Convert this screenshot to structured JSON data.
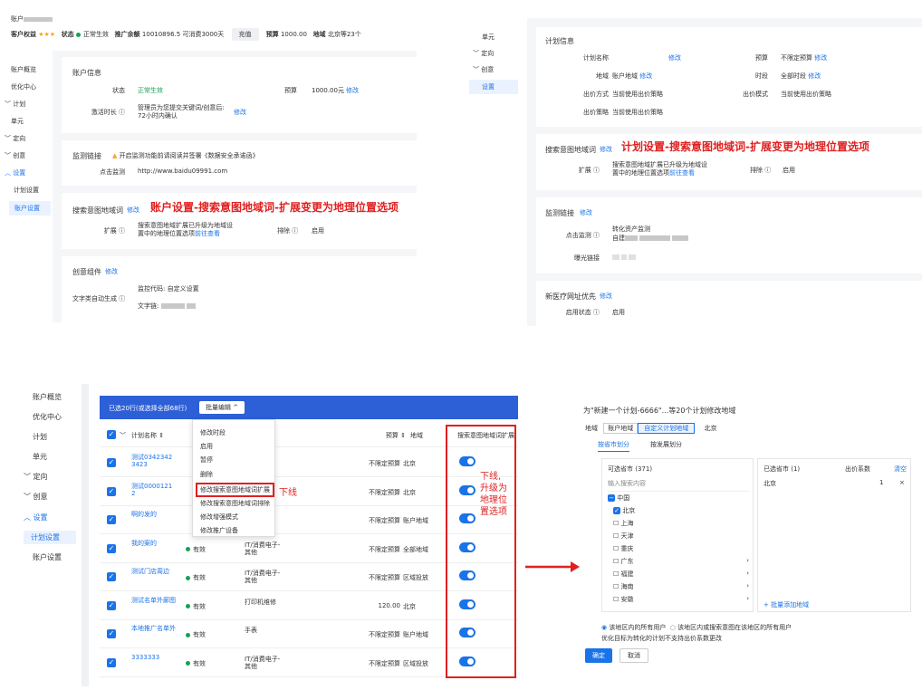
{
  "top_left": {
    "account_label": "账户",
    "rights_label": "客户权益",
    "stars": "★★★",
    "status_label": "状态",
    "status_value": "正常生效",
    "balance_label": "推广余额",
    "balance_value": "10010896.5 可消费3000天",
    "recharge": "充值",
    "budget_label": "预算",
    "budget_value": "1000.00",
    "region_label": "地域",
    "region_value": "北京等23个"
  },
  "left_nav": {
    "items": [
      "账户概览",
      "优化中心",
      "计划",
      "单元",
      "定向",
      "创意",
      "设置",
      "计划设置",
      "账户设置"
    ]
  },
  "account_info": {
    "title": "账户信息",
    "status_label": "状态",
    "status_value": "正常生效",
    "budget_label": "预算",
    "budget_value": "1000.00元",
    "budget_edit": "修改",
    "activation_label": "激活时长",
    "activation_text1": "管理员为您提交关键词/创意后:",
    "activation_text2": "72小时内确认",
    "activation_edit": "修改"
  },
  "monitor": {
    "title": "监测链接",
    "warning": "开启监测功能前请阅读并签署《数据安全承诺函》",
    "click_label": "点击监测",
    "click_value": "http://www.baidu09991.com"
  },
  "search_intent_account": {
    "title": "搜索意图地域词",
    "edit": "修改",
    "annotation": "账户设置-搜索意图地域词-扩展变更为地理位置选项",
    "expand_label": "扩展",
    "expand_text1": "搜索意图地域扩展已升级为地域设",
    "expand_text2": "置中的地理位置选项",
    "expand_link": "前往查看",
    "exclude_label": "排除",
    "exclude_value": "启用"
  },
  "creative": {
    "title": "创意组件",
    "edit": "修改",
    "code_label": "监控代码:",
    "code_value": "自定义设置",
    "auto_label": "文字类自动生成",
    "chain_label": "文字链:"
  },
  "top_right_nav": {
    "items": [
      "单元",
      "定向",
      "创意",
      "设置"
    ]
  },
  "plan_info": {
    "title": "计划信息",
    "name_label": "计划名称",
    "name_edit": "修改",
    "budget_label": "预算",
    "budget_value": "不限定预算",
    "budget_edit": "修改",
    "region_label": "地域",
    "region_value": "账户地域",
    "region_edit": "修改",
    "time_label": "时段",
    "time_value": "全部时段",
    "time_edit": "修改",
    "bid_label": "出价方式",
    "bid_value": "当前使用出价策略",
    "bidmode_label": "出价模式",
    "bidmode_value": "当前使用出价策略",
    "strategy_label": "出价策略",
    "strategy_value": "当前使用出价策略"
  },
  "search_intent_plan": {
    "title": "搜索意图地域词",
    "edit": "修改",
    "annotation": "计划设置-搜索意图地域词-扩展变更为地理位置选项",
    "expand_label": "扩展",
    "expand_text1": "搜索意图地域扩展已升级为地域设",
    "expand_text2": "置中的地理位置选项",
    "expand_link": "前往查看",
    "exclude_label": "排除",
    "exclude_value": "启用"
  },
  "monitor_plan": {
    "title": "监测链接",
    "edit": "修改",
    "click_label": "点击监测",
    "click_value1": "转化资产监测",
    "click_value2": "自建",
    "expose_label": "曝光链接"
  },
  "medical": {
    "title": "新医疗网址优先",
    "edit": "修改",
    "status_label": "启用状态",
    "status_value": "启用"
  },
  "bottom_nav": {
    "items": [
      "账户概览",
      "优化中心",
      "计划",
      "单元",
      "定向",
      "创意",
      "设置",
      "计划设置",
      "账户设置"
    ]
  },
  "table": {
    "selected_text": "已选20行(或选择全部68行)",
    "batch_button": "批量编辑",
    "headers": [
      "计划名称",
      "状态",
      "预算",
      "地域",
      "搜索意图地域词扩展"
    ],
    "menu": [
      "修改时段",
      "启用",
      "暂停",
      "删除",
      "修改搜索意图地域词扩展",
      "修改搜索意图地域词排除",
      "修改增强模式",
      "修改推广设备"
    ],
    "menu_annotation": "下线",
    "col_annotation": [
      "下线,",
      "升级为",
      "地理位",
      "置选项"
    ],
    "rows": [
      {
        "name": "测试0342342 3423",
        "status": "",
        "biz": "",
        "budget": "不限定预算",
        "region": "北京"
      },
      {
        "name": "测试0000121 2",
        "status": "",
        "biz": "",
        "budget": "不限定预算",
        "region": "北京"
      },
      {
        "name": "啊的发的",
        "status": "",
        "biz": "",
        "budget": "不限定预算",
        "region": "账户地域"
      },
      {
        "name": "我的案的",
        "status": "有效",
        "biz": "IT/消费电子-其他",
        "budget": "不限定预算",
        "region": "全部地域"
      },
      {
        "name": "测试门店周边",
        "status": "有效",
        "biz": "IT/消费电子-其他",
        "budget": "不限定预算",
        "region": "区域投放"
      },
      {
        "name": "测试名单外廊图",
        "status": "有效",
        "biz": "打印机维修",
        "budget": "120.00",
        "region": "北京"
      },
      {
        "name": "本地推广名单外",
        "status": "有效",
        "biz": "手表",
        "budget": "不限定预算",
        "region": "账户地域"
      },
      {
        "name": "3333333",
        "status": "有效",
        "biz": "IT/消费电子-其他",
        "budget": "不限定预算",
        "region": "区域投放"
      }
    ]
  },
  "dialog": {
    "title": "为\"新建一个计划-6666\"...等20个计划修改地域",
    "region_label": "地域",
    "opt1": "账户地域",
    "opt2": "自定义计划地域",
    "opt3": "北京",
    "tab1": "按省市划分",
    "tab2": "按发展划分",
    "left_title": "可选省市 (371)",
    "search_ph": "输入搜索内容",
    "tree": [
      "中国",
      "北京",
      "上海",
      "天津",
      "重庆",
      "广东",
      "福建",
      "海南",
      "安徽"
    ],
    "right_title": "已选省市 (1)",
    "coef": "出价系数",
    "clear": "清空",
    "selected_item": "北京",
    "selected_val": "1",
    "batch_add": "+ 批量添加地域",
    "radio1": "该地区内的所有用户",
    "radio2": "该地区内或搜索意图在该地区的所有用户",
    "note": "优化目标为转化的计划不支持出价系数更改",
    "ok": "确定",
    "cancel": "取消"
  }
}
